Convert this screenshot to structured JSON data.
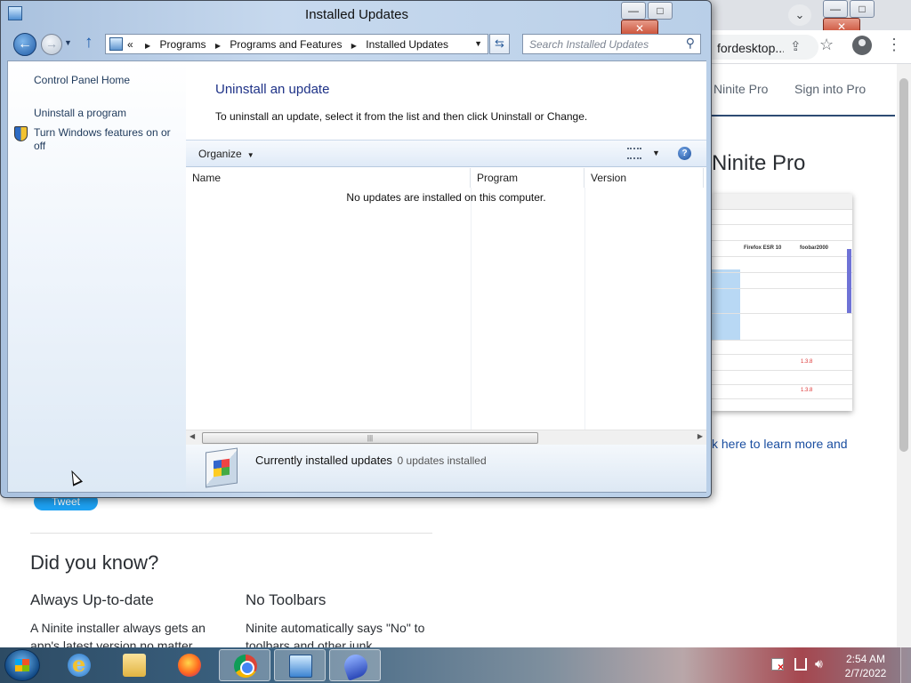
{
  "browser": {
    "url_partial": "fordesktop...",
    "nav": {
      "ninite_pro": "Ninite Pro",
      "sign_in": "Sign into Pro"
    },
    "hero_title": "Ninite Pro",
    "learn_more": "k here to learn more and",
    "screenshot": {
      "headers": [
        "Firefox ESR 10",
        "foobar2000"
      ],
      "red_values": [
        "1.3.8",
        "1.3.8"
      ]
    },
    "tweet_label": "Tweet",
    "did_you_know": "Did you know?",
    "features": [
      {
        "title": "Always Up-to-date",
        "desc": "A Ninite installer always gets an app's latest version no matter"
      },
      {
        "title": "No Toolbars",
        "desc": "Ninite automatically says \"No\" to toolbars and other junk"
      }
    ]
  },
  "window": {
    "title": "Installed Updates",
    "breadcrumbs": [
      "Programs",
      "Programs and Features",
      "Installed Updates"
    ],
    "crumb_prefix": "«",
    "search_placeholder": "Search Installed Updates",
    "sidebar": {
      "items": [
        {
          "label": "Control Panel Home"
        },
        {
          "label": "Uninstall a program"
        },
        {
          "label": "Turn Windows features on or off"
        }
      ]
    },
    "main": {
      "title": "Uninstall an update",
      "description": "To uninstall an update, select it from the list and then click Uninstall or Change.",
      "organize": "Organize",
      "columns": [
        "Name",
        "Program",
        "Version"
      ],
      "empty_message": "No updates are installed on this computer."
    },
    "details": {
      "title": "Currently installed updates",
      "count": "0 updates installed"
    }
  },
  "taskbar": {
    "apps": [
      "Internet Explorer",
      "Windows Explorer",
      "Firefox",
      "Chrome",
      "Control Panel",
      "Ninite"
    ],
    "active_app": "Control Panel",
    "clock": {
      "time": "2:54 AM",
      "date": "2/7/2022"
    }
  },
  "colors": {
    "link": "#1e395b",
    "heading": "#1e3287",
    "taskbar_left": "#2d4b64"
  }
}
